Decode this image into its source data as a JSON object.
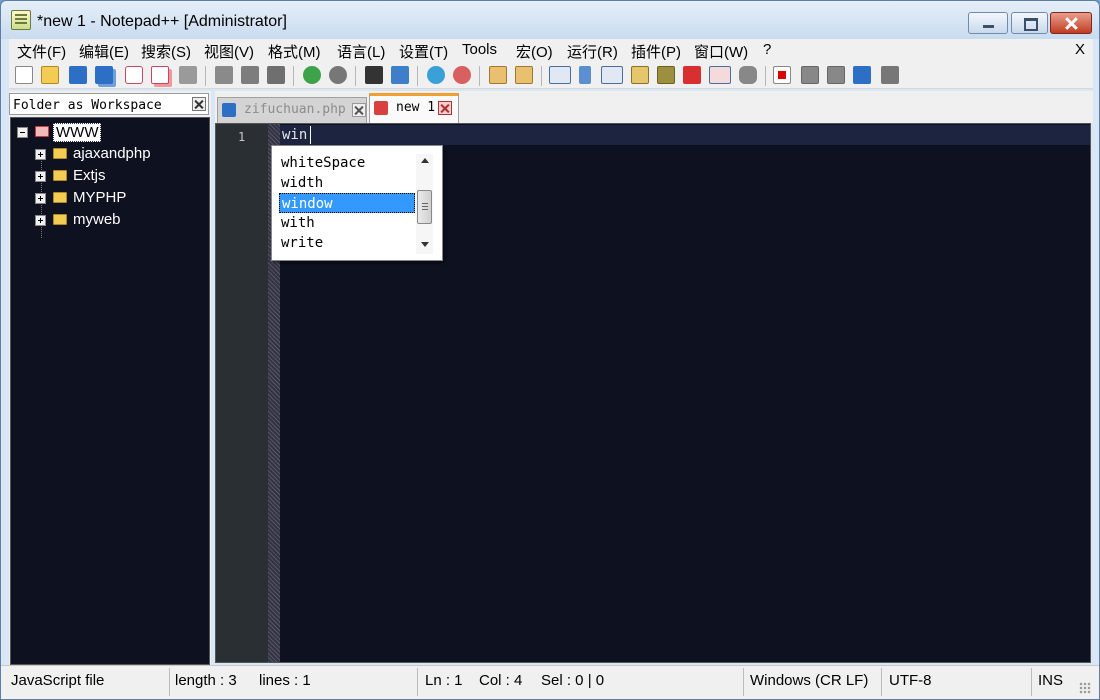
{
  "window": {
    "title": "*new 1 - Notepad++ [Administrator]"
  },
  "menu": {
    "items": [
      "文件(F)",
      "编辑(E)",
      "搜索(S)",
      "视图(V)",
      "格式(M)",
      "语言(L)",
      "设置(T)",
      "Tools",
      "宏(O)",
      "运行(R)",
      "插件(P)",
      "窗口(W)",
      "?"
    ],
    "close_label": "X"
  },
  "toolbar": {
    "icons": [
      "new-file-icon",
      "open-file-icon",
      "save-icon",
      "save-all-icon",
      "close-icon",
      "close-all-icon",
      "print-icon",
      "cut-icon",
      "copy-icon",
      "paste-icon",
      "undo-icon",
      "redo-icon",
      "find-icon",
      "replace-icon",
      "zoom-in-icon",
      "zoom-out-icon",
      "sync-vertical-icon",
      "sync-horizontal-icon",
      "word-wrap-icon",
      "show-all-chars-icon",
      "indent-guide-icon",
      "user-lang-icon",
      "doc-map-icon",
      "function-list-icon",
      "folder-workspace-icon",
      "monitoring-icon",
      "record-macro-icon",
      "stop-macro-icon",
      "play-macro-icon",
      "run-macro-multiple-icon",
      "save-macro-icon"
    ]
  },
  "workspace_panel": {
    "title": "Folder as Workspace",
    "tree": {
      "root": "WWW",
      "children": [
        "ajaxandphp",
        "Extjs",
        "MYPHP",
        "myweb"
      ]
    }
  },
  "tabs": [
    {
      "label": "zifuchuan.php",
      "active": false
    },
    {
      "label": "new 1",
      "active": true
    }
  ],
  "editor": {
    "line_numbers": [
      "1"
    ],
    "lines": [
      "win"
    ]
  },
  "autocomplete": {
    "items": [
      "whiteSpace",
      "width",
      "window",
      "with",
      "write"
    ],
    "selected": "window"
  },
  "status": {
    "file_type": "JavaScript file",
    "length": "length : 3",
    "lines": "lines : 1",
    "ln": "Ln : 1",
    "col": "Col : 4",
    "sel": "Sel : 0 | 0",
    "eol": "Windows (CR LF)",
    "encoding": "UTF-8",
    "mode": "INS"
  },
  "colors": {
    "editor_bg": "#0d1120",
    "selection": "#3399ff",
    "active_tab_accent": "#f0a030"
  }
}
